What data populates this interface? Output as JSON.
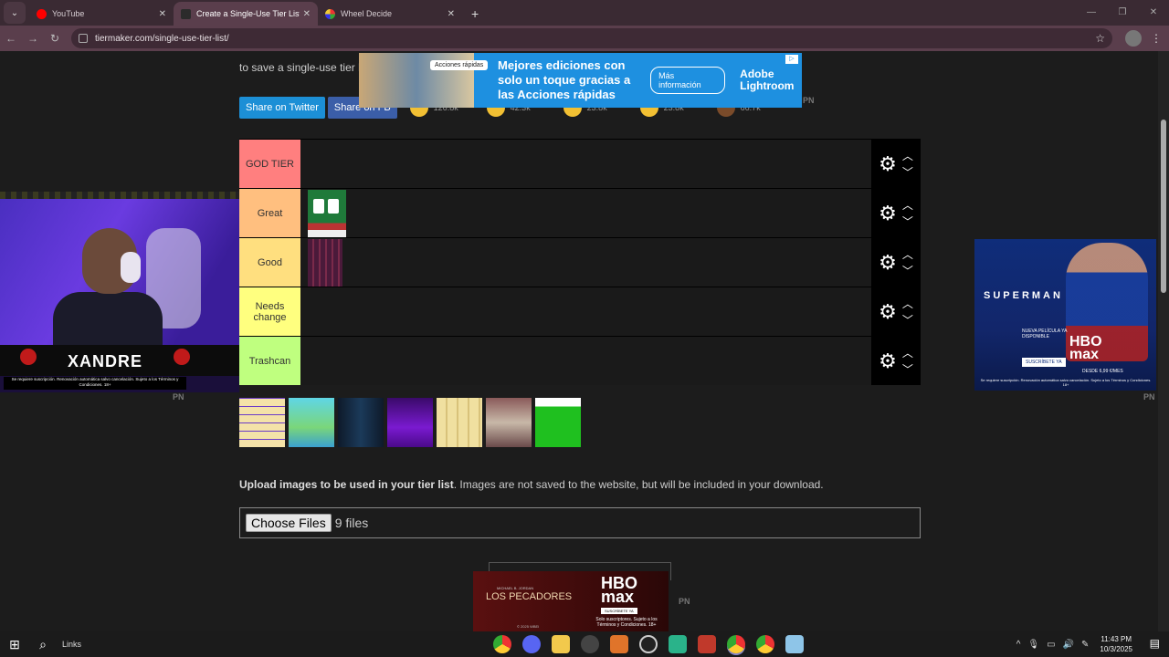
{
  "browser": {
    "tabs": [
      {
        "title": "YouTube",
        "favicon_color": "#ff0000",
        "active": false
      },
      {
        "title": "Create a Single-Use Tier List (P",
        "favicon_color": "#2b2b2b",
        "active": true
      },
      {
        "title": "Wheel Decide",
        "favicon_color": "#e0a000",
        "active": false
      }
    ],
    "url": "tiermaker.com/single-use-tier-list/"
  },
  "page": {
    "intro_line": "to save a single-use tier lis",
    "share": {
      "twitter": "Share on Twitter",
      "facebook": "Share on FB"
    },
    "reactions": [
      {
        "icon": "grin-emoji-icon",
        "count": "126.8k"
      },
      {
        "icon": "laugh-emoji-icon",
        "count": "42.3k"
      },
      {
        "icon": "smile-emoji-icon",
        "count": "23.8k"
      },
      {
        "icon": "hands-emoji-icon",
        "count": "23.8k"
      },
      {
        "icon": "poop-emoji-icon",
        "count": "66.7k"
      }
    ],
    "tiers": [
      {
        "label": "GOD TIER",
        "color": "#ff7f7f",
        "items": []
      },
      {
        "label": "Great",
        "color": "#ffbf7f",
        "items": [
          "solitaire"
        ]
      },
      {
        "label": "Good",
        "color": "#ffdf7f",
        "items": [
          "purple-grid"
        ]
      },
      {
        "label": "Needs change",
        "color": "#ffff7f",
        "items": []
      },
      {
        "label": "Trashcan",
        "color": "#bfff7f",
        "items": []
      }
    ],
    "pool_items": [
      "number-puzzle",
      "candy-game",
      "dark-pillars",
      "purple-game",
      "bowling-lanes",
      "kitchen-scene",
      "green-solitaire"
    ],
    "upload_bold": "Upload images to be used in your tier list",
    "upload_rest": ". Images are not saved to the website, but will be included in your download.",
    "file_button": "Choose Files",
    "file_count": "9 files",
    "pn_label": "PN"
  },
  "ads": {
    "top": {
      "pill": "Acciones rápidas",
      "headline": "Mejores ediciones con solo un toque gracias a las Acciones rápidas",
      "cta": "Más información",
      "brand": "Adobe Lightroom"
    },
    "right": {
      "title": "SUPERMAN",
      "sub": "NUEVA PELÍCULA YA DISPONIBLE",
      "logo": "HBO max",
      "cta": "SUSCRÍBETE YA",
      "price": "DESDE 6,99 €/MES",
      "legal": "Se requiere suscripción. Renovación automática salvo cancelación. Sujeto a los Términos y Condiciones. 18+"
    },
    "bottom": {
      "credits": "MICHAEL B. JORDAN",
      "movie": "LOS PECADORES",
      "logo": "HBO max",
      "cta": "SUSCRÍBETE YA",
      "legal": "Solo suscriptores. Sujeto a los Términos y Condiciones. 18+",
      "year": "© 2025 WBEI"
    }
  },
  "webcam": {
    "name": "XANDRE",
    "legal": "Se requiere suscripción. Renovación automática salvo cancelación. Sujeto a los Términos y Condiciones. 18+"
  },
  "taskbar": {
    "search_label": "Links",
    "time": "11:43 PM",
    "date": "10/3/2025"
  }
}
